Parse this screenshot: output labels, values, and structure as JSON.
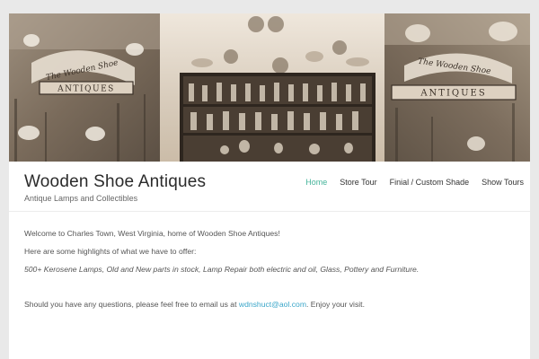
{
  "banner": {
    "left_sign": {
      "script": "The Wooden Shoe",
      "plate": "ANTIQUES"
    },
    "right_sign": {
      "script": "The Wooden Shoe",
      "plate": "ANTIQUES"
    }
  },
  "header": {
    "site_title": "Wooden Shoe Antiques",
    "tagline": "Antique Lamps and Collectibles"
  },
  "nav": {
    "items": [
      {
        "label": "Home",
        "active": true
      },
      {
        "label": "Store Tour",
        "active": false
      },
      {
        "label": "Finial / Custom Shade",
        "active": false
      },
      {
        "label": "Show Tours",
        "active": false
      }
    ]
  },
  "content": {
    "welcome": "Welcome to Charles Town, West Virginia, home of Wooden Shoe Antiques!",
    "highlights_intro": "Here are some highlights of what we have to offer:",
    "highlights": "500+ Kerosene Lamps, Old and New parts in stock, Lamp Repair both electric and oil, Glass, Pottery and Furniture.",
    "contact_before": "Should you have any questions, please feel free to email us at ",
    "contact_email": "wdnshuct@aol.com",
    "contact_after": ". Enjoy your visit."
  },
  "colors": {
    "accent": "#45b49a",
    "link": "#3aa6c9",
    "page_bg": "#e9e9e9"
  }
}
